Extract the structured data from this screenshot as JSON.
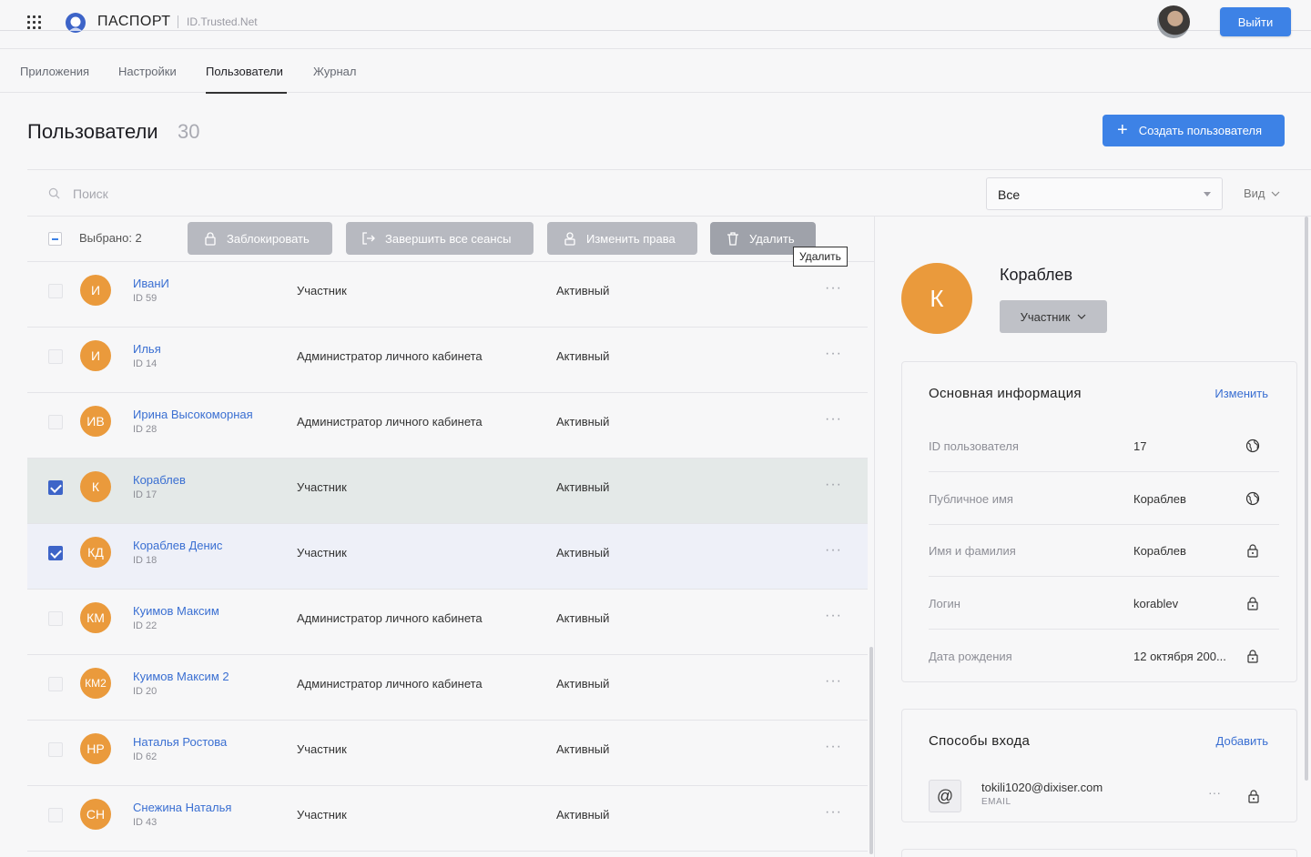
{
  "header": {
    "brand": "ПАСПОРТ",
    "brand_sub": "ID.Trusted.Net",
    "logout_label": "Выйти"
  },
  "nav": {
    "tabs": [
      {
        "label": "Приложения"
      },
      {
        "label": "Настройки"
      },
      {
        "label": "Пользователи",
        "active": true
      },
      {
        "label": "Журнал"
      }
    ]
  },
  "page": {
    "title": "Пользователи",
    "count": "30",
    "create_label": "Создать пользователя"
  },
  "search": {
    "placeholder": "Поиск",
    "filter_value": "Все",
    "view_label": "Вид"
  },
  "bulk": {
    "selected_label": "Выбрано: 2",
    "actions": [
      {
        "label": "Заблокировать",
        "icon": "lock-icon"
      },
      {
        "label": "Завершить все сеансы",
        "icon": "logout-icon"
      },
      {
        "label": "Изменить права",
        "icon": "user-rights-icon"
      },
      {
        "label": "Удалить",
        "icon": "trash-icon"
      }
    ],
    "tooltip": "Удалить"
  },
  "users": [
    {
      "initials": "И",
      "name": "ИванИ",
      "id": "ID 59",
      "role": "Участник",
      "status": "Активный",
      "checked": false
    },
    {
      "initials": "И",
      "name": "Илья",
      "id": "ID 14",
      "role": "Администратор личного кабинета",
      "status": "Активный",
      "checked": false
    },
    {
      "initials": "ИВ",
      "name": "Ирина Высокоморная",
      "id": "ID 28",
      "role": "Администратор личного кабинета",
      "status": "Активный",
      "checked": false
    },
    {
      "initials": "К",
      "name": "Кораблев",
      "id": "ID 17",
      "role": "Участник",
      "status": "Активный",
      "checked": true
    },
    {
      "initials": "КД",
      "name": "Кораблев Денис",
      "id": "ID 18",
      "role": "Участник",
      "status": "Активный",
      "checked": true
    },
    {
      "initials": "КМ",
      "name": "Куимов Максим",
      "id": "ID 22",
      "role": "Администратор личного кабинета",
      "status": "Активный",
      "checked": false
    },
    {
      "initials": "КМ2",
      "name": "Куимов Максим 2",
      "id": "ID 20",
      "role": "Администратор личного кабинета",
      "status": "Активный",
      "checked": false
    },
    {
      "initials": "НР",
      "name": "Наталья Ростова",
      "id": "ID 62",
      "role": "Участник",
      "status": "Активный",
      "checked": false
    },
    {
      "initials": "СН",
      "name": "Снежина Наталья",
      "id": "ID 43",
      "role": "Участник",
      "status": "Активный",
      "checked": false
    }
  ],
  "detail": {
    "initials": "К",
    "name": "Кораблев",
    "role_label": "Участник",
    "info": {
      "title": "Основная информация",
      "edit_label": "Изменить",
      "rows": [
        {
          "label": "ID пользователя",
          "value": "17",
          "icon": "globe-icon"
        },
        {
          "label": "Публичное имя",
          "value": "Кораблев",
          "icon": "globe-icon"
        },
        {
          "label": "Имя и фамилия",
          "value": "Кораблев",
          "icon": "lock-icon"
        },
        {
          "label": "Логин",
          "value": "korablev",
          "icon": "lock-icon"
        },
        {
          "label": "Дата рождения",
          "value": "12 октября 200...",
          "icon": "lock-icon"
        }
      ]
    },
    "logins": {
      "title": "Способы входа",
      "add_label": "Добавить",
      "items": [
        {
          "icon": "@",
          "value": "tokili1020@dixiser.com",
          "type": "EMAIL"
        }
      ]
    }
  },
  "colors": {
    "accent": "#3d82e6",
    "avatar": "#ea9a3c",
    "link": "#3a6fd2"
  }
}
